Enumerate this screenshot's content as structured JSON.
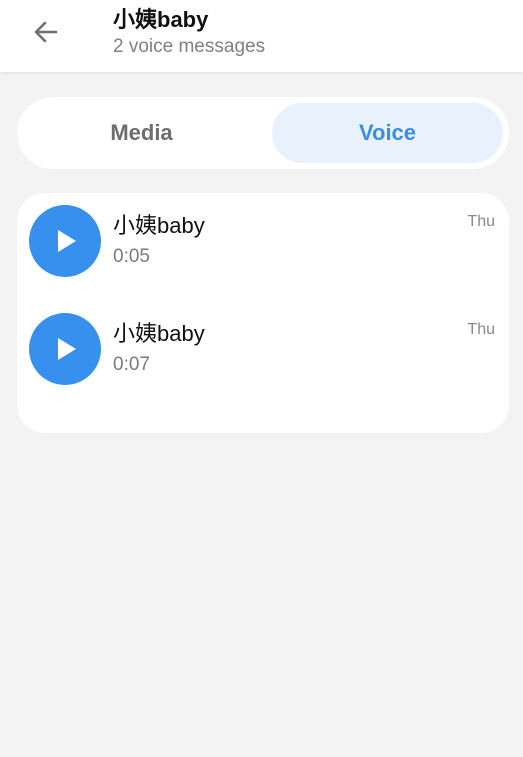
{
  "header": {
    "back_icon": "arrow-left-icon",
    "title": "小姨baby",
    "subtitle": "2 voice messages"
  },
  "tabs": [
    {
      "label": "Media",
      "selected": false
    },
    {
      "label": "Voice",
      "selected": true
    }
  ],
  "voice_messages": [
    {
      "sender": "小姨baby",
      "duration": "0:05",
      "date": "Thu",
      "icon": "play-icon"
    },
    {
      "sender": "小姨baby",
      "duration": "0:07",
      "date": "Thu",
      "icon": "play-icon"
    }
  ],
  "colors": {
    "accent": "#3790ee",
    "selected_tab_bg": "#e9f2fc",
    "background": "#f3f3f3"
  }
}
